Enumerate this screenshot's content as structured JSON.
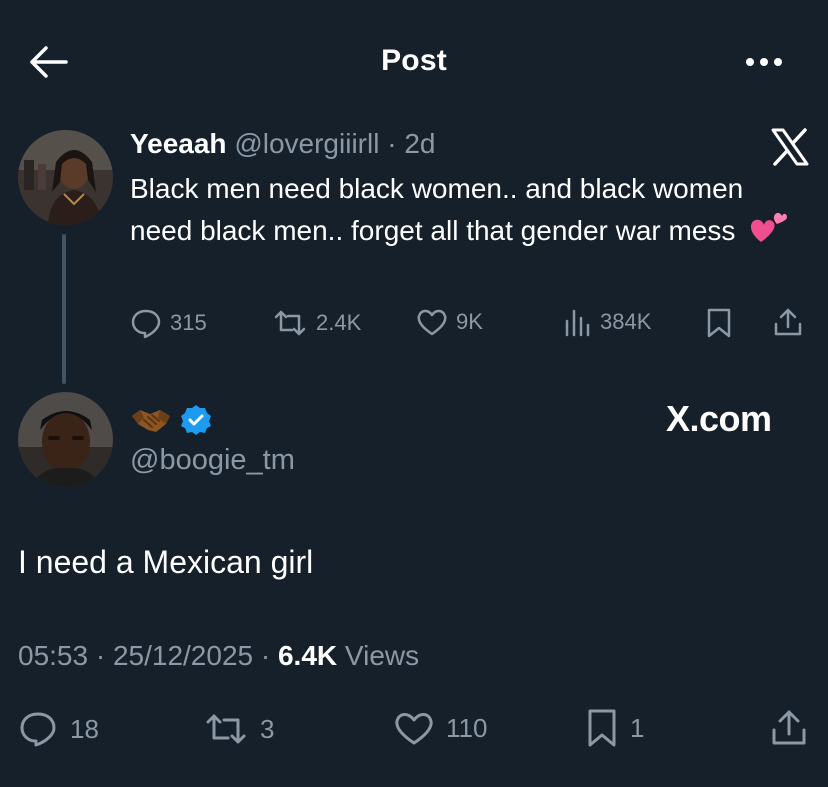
{
  "header": {
    "title": "Post"
  },
  "quoted_tweet": {
    "name": "Yeeaah",
    "handle": "@lovergiiirll",
    "time": "· 2d",
    "text": "Black men need black women.. and black women need black men.. forget all that gender war mess",
    "emoji": "two-hearts",
    "replies": "315",
    "reposts": "2.4K",
    "likes": "9K",
    "views": "384K"
  },
  "main_tweet": {
    "name_emoji": "handshake",
    "verified": true,
    "handle": "@boogie_tm",
    "watermark": "X.com",
    "text": "I need a Mexican girl",
    "timestamp": "05:53 · 25/12/2025 ·",
    "views_count": "6.4K",
    "views_label": "Views",
    "replies": "18",
    "reposts": "3",
    "likes": "110",
    "bookmarks": "1"
  },
  "colors": {
    "background": "#15202b",
    "secondary_text": "#8b98a5",
    "verified_blue": "#1d9bf0",
    "heart_pink": "#f04f8f"
  }
}
